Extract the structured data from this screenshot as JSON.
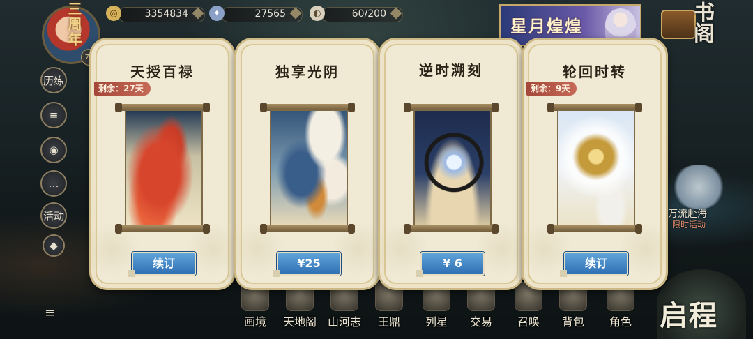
{
  "resources": [
    {
      "icon": "coin-icon",
      "value": "3354834"
    },
    {
      "icon": "jade-icon",
      "value": "27565"
    },
    {
      "icon": "stamina-icon",
      "value": "60/200"
    }
  ],
  "player": {
    "level": "70",
    "anniversary_badge": "三周年"
  },
  "sidebar": [
    {
      "label": "历练"
    },
    {
      "label": "≡"
    },
    {
      "label": "◉"
    },
    {
      "label": "…"
    },
    {
      "label": "活动"
    },
    {
      "label": "◆"
    }
  ],
  "top_right": {
    "banner_title": "星月煌煌",
    "book_button": "书阁"
  },
  "event": {
    "title": "万流赴海",
    "subtitle": "限时活动"
  },
  "cards": [
    {
      "title": "天授百禄",
      "remaining": "剩余：27天",
      "button": "续订",
      "art": "phoenix"
    },
    {
      "title": "独享光阴",
      "remaining": "",
      "button": "¥25",
      "art": "dragon"
    },
    {
      "title": "逆时溯刻",
      "remaining": "",
      "button": "¥ 6",
      "art": "moon"
    },
    {
      "title": "轮回时转",
      "remaining": "剩余：9天",
      "button": "续订",
      "art": "wheel"
    }
  ],
  "bottom_nav": [
    "画境",
    "天地阁",
    "山河志",
    "王鼎",
    "列星",
    "交易",
    "召唤",
    "背包",
    "角色"
  ],
  "start_button": "启程",
  "colors": {
    "card_bg": "#f0ead5",
    "price_button": "#2f6fb4",
    "remain_tag": "#a4473a"
  }
}
